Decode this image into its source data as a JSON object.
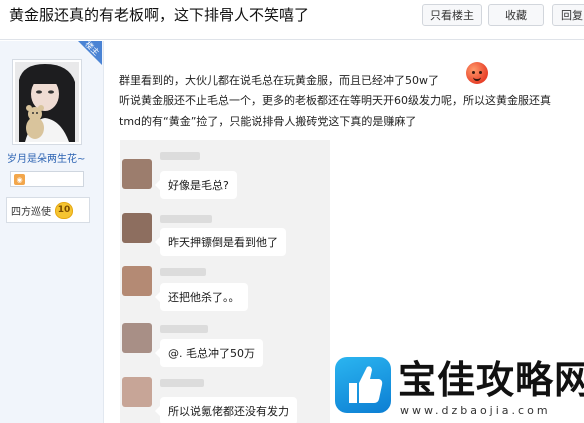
{
  "header": {
    "title": "黄金服还真的有老板啊，这下排骨人不笑嘻了",
    "only_op_label": "只看楼主",
    "favorite_label": "收藏",
    "reply_label": "回复"
  },
  "author": {
    "op_tag": "楼主",
    "name": "岁月是朵两生花~",
    "level_title": "四方巡使",
    "level_number": "10"
  },
  "post": {
    "lines": [
      "群里看到的，大伙儿都在说毛总在玩黄金服，而且已经冲了50w了",
      "听说黄金服还不止毛总一个，更多的老板都还在等明天开60级发力呢，所以这黄金服还真",
      "tmd的有“黄金”捡了，只能说排骨人搬砖党这下真的是赚麻了"
    ],
    "emoji": "smile-emoji"
  },
  "chat": {
    "messages": [
      "好像是毛总?",
      "昨天押镖倒是看到他了",
      "还把他杀了。。",
      "@. 毛总冲了50万",
      "所以说氪佬都还没有发力"
    ]
  },
  "watermark": {
    "name": "宝佳攻略网",
    "url": "www.dzbaojia.com"
  },
  "colors": {
    "accent": "#4a83d4",
    "author_link": "#2d64b3",
    "panel_bg": "#f1f5fb",
    "chat_bg": "#f2f2f2",
    "logo_blue": "#1a98e3"
  }
}
